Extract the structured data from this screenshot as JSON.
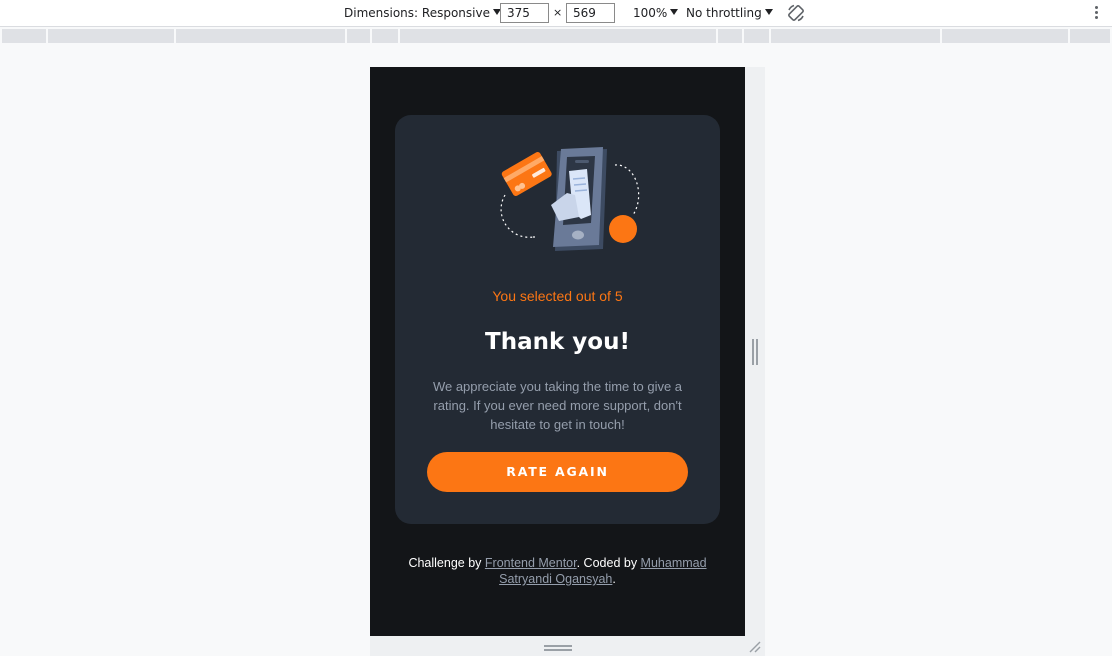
{
  "devtools": {
    "dimensions_label": "Dimensions: Responsive",
    "width_value": "375",
    "times_symbol": "×",
    "height_value": "569",
    "zoom": "100%",
    "throttling": "No throttling"
  },
  "card": {
    "selected_text": "You selected out of 5",
    "title": "Thank you!",
    "description": "We appreciate you taking the time to give a rating. If you ever need more support, don't hesitate to get in touch!",
    "button_label": "RATE AGAIN"
  },
  "footer": {
    "prefix": "Challenge by ",
    "link1": "Frontend Mentor",
    "middle": ". Coded by ",
    "link2": "Muhammad Satryandi Ogansyah",
    "suffix": "."
  },
  "colors": {
    "accent": "#fc7614",
    "card_bg": "#232a34",
    "page_bg": "#131518",
    "muted_text": "#959eac"
  }
}
